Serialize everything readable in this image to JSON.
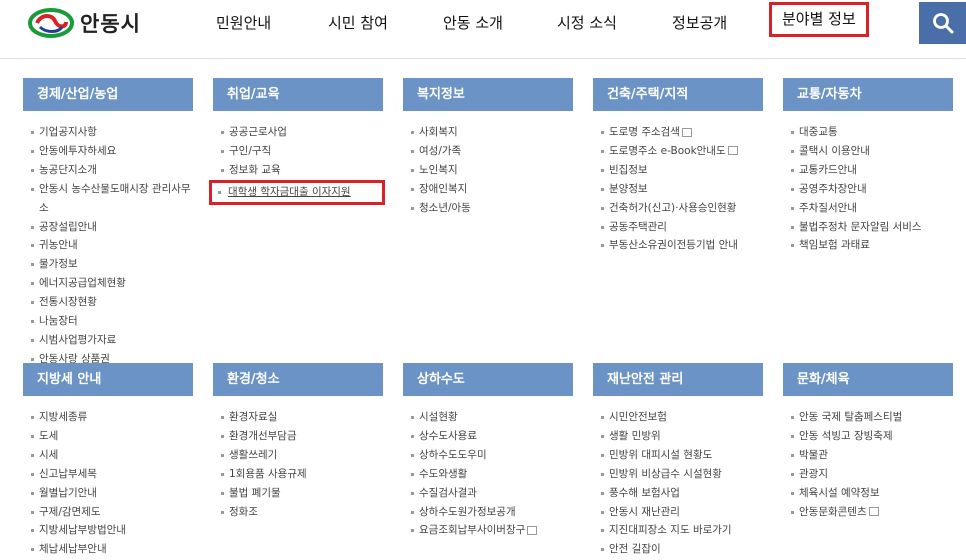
{
  "header": {
    "logo_text": "안동시",
    "nav": [
      "민원안내",
      "시민 참여",
      "안동 소개",
      "시정 소식",
      "정보공개",
      "분야별 정보"
    ]
  },
  "row1": [
    {
      "title": "경제/산업/농업",
      "items": [
        "기업공지사항",
        "안동에투자하세요",
        "농공단지소개",
        "안동시 농수산물도매시장 관리사무소",
        "공장설립안내",
        "귀농안내",
        "물가정보",
        "에너지공급업체현황",
        "전통시장현황",
        "나눔장터",
        "시범사업평가자료",
        "안동사랑 상품권"
      ]
    },
    {
      "title": "취업/교육",
      "items": [
        "공공근로사업",
        "구인/구직",
        "정보화 교육",
        "대학생 학자금대출 이자지원"
      ]
    },
    {
      "title": "복지정보",
      "items": [
        "사회복지",
        "여성/가족",
        "노인복지",
        "장애인복지",
        "청소년/아동"
      ]
    },
    {
      "title": "건축/주택/지적",
      "items": [
        "도로명 주소검색",
        "도로명주소 e-Book안내도",
        "빈집정보",
        "분양정보",
        "건축허가(신고)·사용승인현황",
        "공동주택관리",
        "부동산소유권이전등기법 안내"
      ]
    },
    {
      "title": "교통/자동차",
      "items": [
        "대중교통",
        "콜택시 이용안내",
        "교통카드안내",
        "공영주차장안내",
        "주차질서안내",
        "불법주정차 문자알림 서비스",
        "책임보험 과태료"
      ]
    }
  ],
  "row2": [
    {
      "title": "지방세 안내",
      "items": [
        "지방세종류",
        "도세",
        "시세",
        "신고납부세목",
        "월별납기안내",
        "구제/감면제도",
        "지방세납부방법안내",
        "체납세납부안내"
      ]
    },
    {
      "title": "환경/청소",
      "items": [
        "환경자료실",
        "환경개선부담금",
        "생활쓰레기",
        "1회용품 사용규제",
        "불법 폐기물",
        "정화조"
      ]
    },
    {
      "title": "상하수도",
      "items": [
        "시설현황",
        "상수도사용료",
        "상하수도도우미",
        "수도와생활",
        "수질검사결과",
        "상하수도원가정보공개",
        "요금조회납부사이버창구"
      ]
    },
    {
      "title": "재난안전 관리",
      "items": [
        "시민안전보험",
        "생활 민방위",
        "민방위 대피시설 현황도",
        "민방위 비상급수 시설현황",
        "풍수해 보험사업",
        "안동시 재난관리",
        "지진대피장소 지도 바로가기",
        "안전 길잡이"
      ]
    },
    {
      "title": "문화/체육",
      "items": [
        "안동 국제 탈춤페스티벌",
        "안동 석빙고 장빙축제",
        "박물관",
        "관광지",
        "체육시설 예약정보",
        "안동문화콘텐츠"
      ]
    }
  ]
}
